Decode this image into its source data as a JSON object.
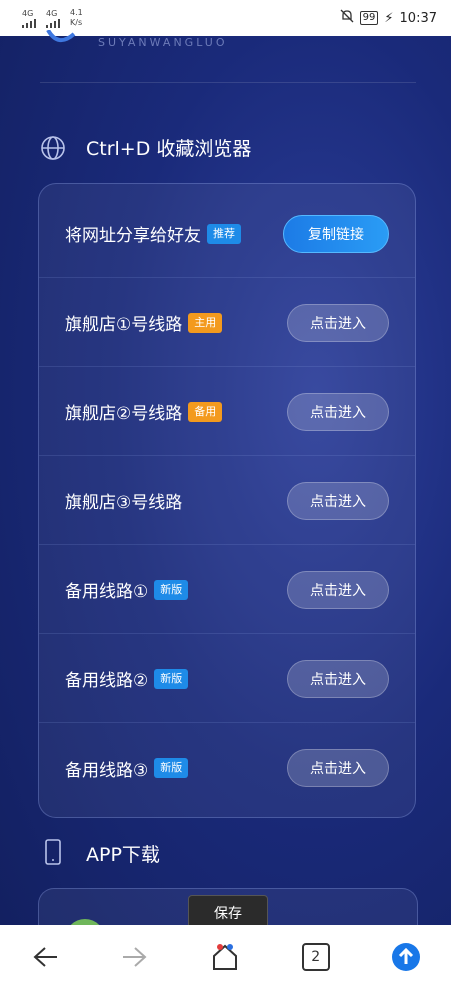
{
  "status_bar": {
    "signal_1": "4G",
    "signal_2": "4G",
    "speed": "4.1",
    "speed_unit": "K/s",
    "battery": "99",
    "time": "10:37"
  },
  "brand": {
    "text": "SUYANWANGLUO"
  },
  "bookmark_section": {
    "title": "Ctrl+D 收藏浏览器"
  },
  "rows": [
    {
      "label": "将网址分享给好友",
      "badge": "推荐",
      "badge_color": "#1e8be8",
      "button": "复制链接",
      "primary": true
    },
    {
      "label": "旗舰店①号线路",
      "badge": "主用",
      "badge_color": "#f39a1e",
      "button": "点击进入"
    },
    {
      "label": "旗舰店②号线路",
      "badge": "备用",
      "badge_color": "#f39a1e",
      "button": "点击进入"
    },
    {
      "label": "旗舰店③号线路",
      "badge": "",
      "button": "点击进入"
    },
    {
      "label": "备用线路①",
      "badge": "新版",
      "badge_color": "#1e8be8",
      "button": "点击进入"
    },
    {
      "label": "备用线路②",
      "badge": "新版",
      "badge_color": "#1e8be8",
      "button": "点击进入"
    },
    {
      "label": "备用线路③",
      "badge": "新版",
      "badge_color": "#1e8be8",
      "button": "点击进入"
    }
  ],
  "app_section": {
    "title": "APP下载"
  },
  "save_chip": "保存",
  "nav": {
    "tab_count": "2",
    "icons": [
      "back-arrow-icon",
      "forward-arrow-icon",
      "home-icon",
      "tabs-icon",
      "upload-icon"
    ]
  }
}
